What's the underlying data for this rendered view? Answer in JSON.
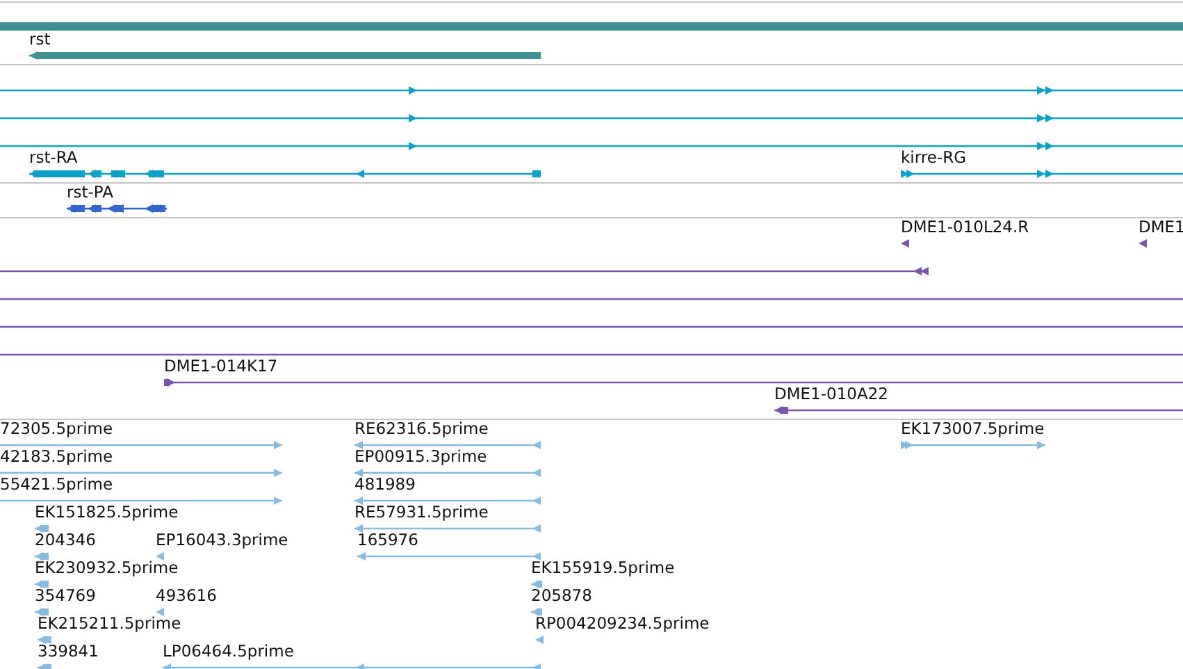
{
  "tracks": [
    {
      "kind": "gene",
      "features": [
        {
          "kind": "plain"
        },
        {
          "label": "rst",
          "kind": "reverse"
        }
      ]
    },
    {
      "kind": "transcript",
      "features": [
        {
          "kind": "forward"
        },
        {
          "kind": "forward"
        },
        {
          "kind": "forward"
        },
        {
          "label": "rst-RA",
          "kind": "reverse"
        },
        {
          "label": "kirre-RG",
          "kind": "forward"
        }
      ]
    },
    {
      "kind": "protein",
      "features": [
        {
          "label": "rst-PA",
          "kind": "reverse"
        }
      ]
    },
    {
      "kind": "clone",
      "features": [
        {
          "label": "DME1-010L24.R",
          "kind": "reverse"
        },
        {
          "label": "DME1",
          "kind": "reverse"
        },
        {
          "kind": "reverse"
        },
        {
          "kind": "plain"
        },
        {
          "kind": "plain"
        },
        {
          "kind": "plain"
        },
        {
          "label": "DME1-014K17",
          "kind": "forward"
        },
        {
          "label": "DME1-010A22",
          "kind": "reverse"
        }
      ]
    },
    {
      "kind": "est",
      "features": [
        {
          "label": "72305.5prime",
          "kind": "forward"
        },
        {
          "label": "RE62316.5prime",
          "kind": "reverse"
        },
        {
          "label": "EK173007.5prime",
          "kind": "forward"
        },
        {
          "label": "42183.5prime",
          "kind": "forward"
        },
        {
          "label": "EP00915.3prime",
          "kind": "reverse"
        },
        {
          "label": "55421.5prime",
          "kind": "forward"
        },
        {
          "label": "481989",
          "kind": "reverse"
        },
        {
          "label": "EK151825.5prime",
          "kind": "reverse"
        },
        {
          "label": "RE57931.5prime",
          "kind": "reverse"
        },
        {
          "label": "204346",
          "kind": "reverse"
        },
        {
          "label": "EP16043.3prime",
          "kind": "reverse"
        },
        {
          "label": "165976",
          "kind": "reverse"
        },
        {
          "label": "EK230932.5prime",
          "kind": "reverse"
        },
        {
          "label": "EK155919.5prime",
          "kind": "reverse"
        },
        {
          "label": "354769",
          "kind": "reverse"
        },
        {
          "label": "493616",
          "kind": "reverse"
        },
        {
          "label": "205878",
          "kind": "reverse"
        },
        {
          "label": "EK215211.5prime",
          "kind": "reverse"
        },
        {
          "label": "RP004209234.5prime",
          "kind": "reverse"
        },
        {
          "label": "339841",
          "kind": "reverse"
        },
        {
          "label": "LP06464.5prime",
          "kind": "reverse"
        }
      ]
    }
  ]
}
